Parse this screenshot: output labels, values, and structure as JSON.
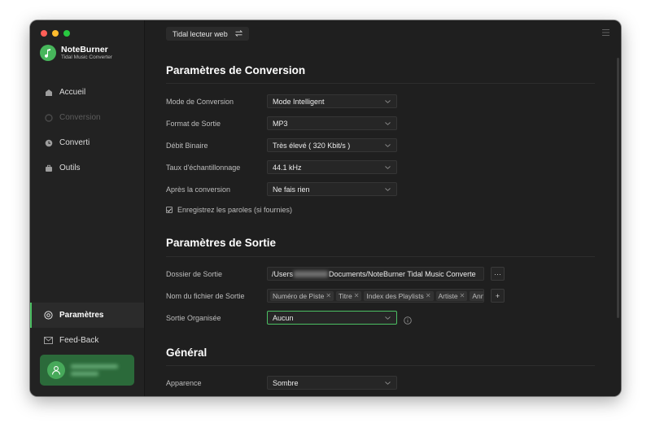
{
  "app": {
    "name": "NoteBurner",
    "subtitle": "Tidal Music Converter"
  },
  "sidebar": {
    "items": [
      {
        "label": "Accueil",
        "icon": "home-icon",
        "enabled": true
      },
      {
        "label": "Conversion",
        "icon": "conversion-icon",
        "enabled": false
      },
      {
        "label": "Converti",
        "icon": "clock-icon",
        "enabled": true
      },
      {
        "label": "Outils",
        "icon": "toolbox-icon",
        "enabled": true
      }
    ],
    "bottom_items": [
      {
        "label": "Paramètres",
        "icon": "gear-icon",
        "active": true
      },
      {
        "label": "Feed-Back",
        "icon": "mail-icon",
        "active": false
      }
    ]
  },
  "header": {
    "source_label": "Tidal lecteur web",
    "source_switch_icon": "switch-arrows-icon",
    "menu_icon": "hamburger-menu-icon"
  },
  "conversion": {
    "title": "Paramètres de Conversion",
    "rows": [
      {
        "label": "Mode de Conversion",
        "value": "Mode Intelligent"
      },
      {
        "label": "Format de Sortie",
        "value": "MP3"
      },
      {
        "label": "Débit Binaire",
        "value": "Très élevé ( 320 Kbit/s )"
      },
      {
        "label": "Taux d'échantillonnage",
        "value": "44.1 kHz"
      },
      {
        "label": "Après la conversion",
        "value": "Ne fais rien"
      }
    ],
    "lyrics_checkbox": {
      "label": "Enregistrez les paroles (si fournies)",
      "checked": true
    }
  },
  "output": {
    "title": "Paramètres de Sortie",
    "folder_label": "Dossier de Sortie",
    "folder_prefix": "/Users",
    "folder_suffix": "Documents/NoteBurner Tidal Music Converte",
    "browse_label": "···",
    "filename_label": "Nom du fichier de Sortie",
    "filename_tags": [
      "Numéro de Piste",
      "Titre",
      "Index des Playlists",
      "Artiste",
      "Ann"
    ],
    "add_label": "+",
    "organized_label": "Sortie Organisée",
    "organized_value": "Aucun"
  },
  "general": {
    "title": "Général",
    "appearance_label": "Apparence",
    "appearance_value": "Sombre"
  },
  "colors": {
    "accent": "#4cbf63",
    "background": "#1f1f1f",
    "sidebar": "#222222"
  }
}
